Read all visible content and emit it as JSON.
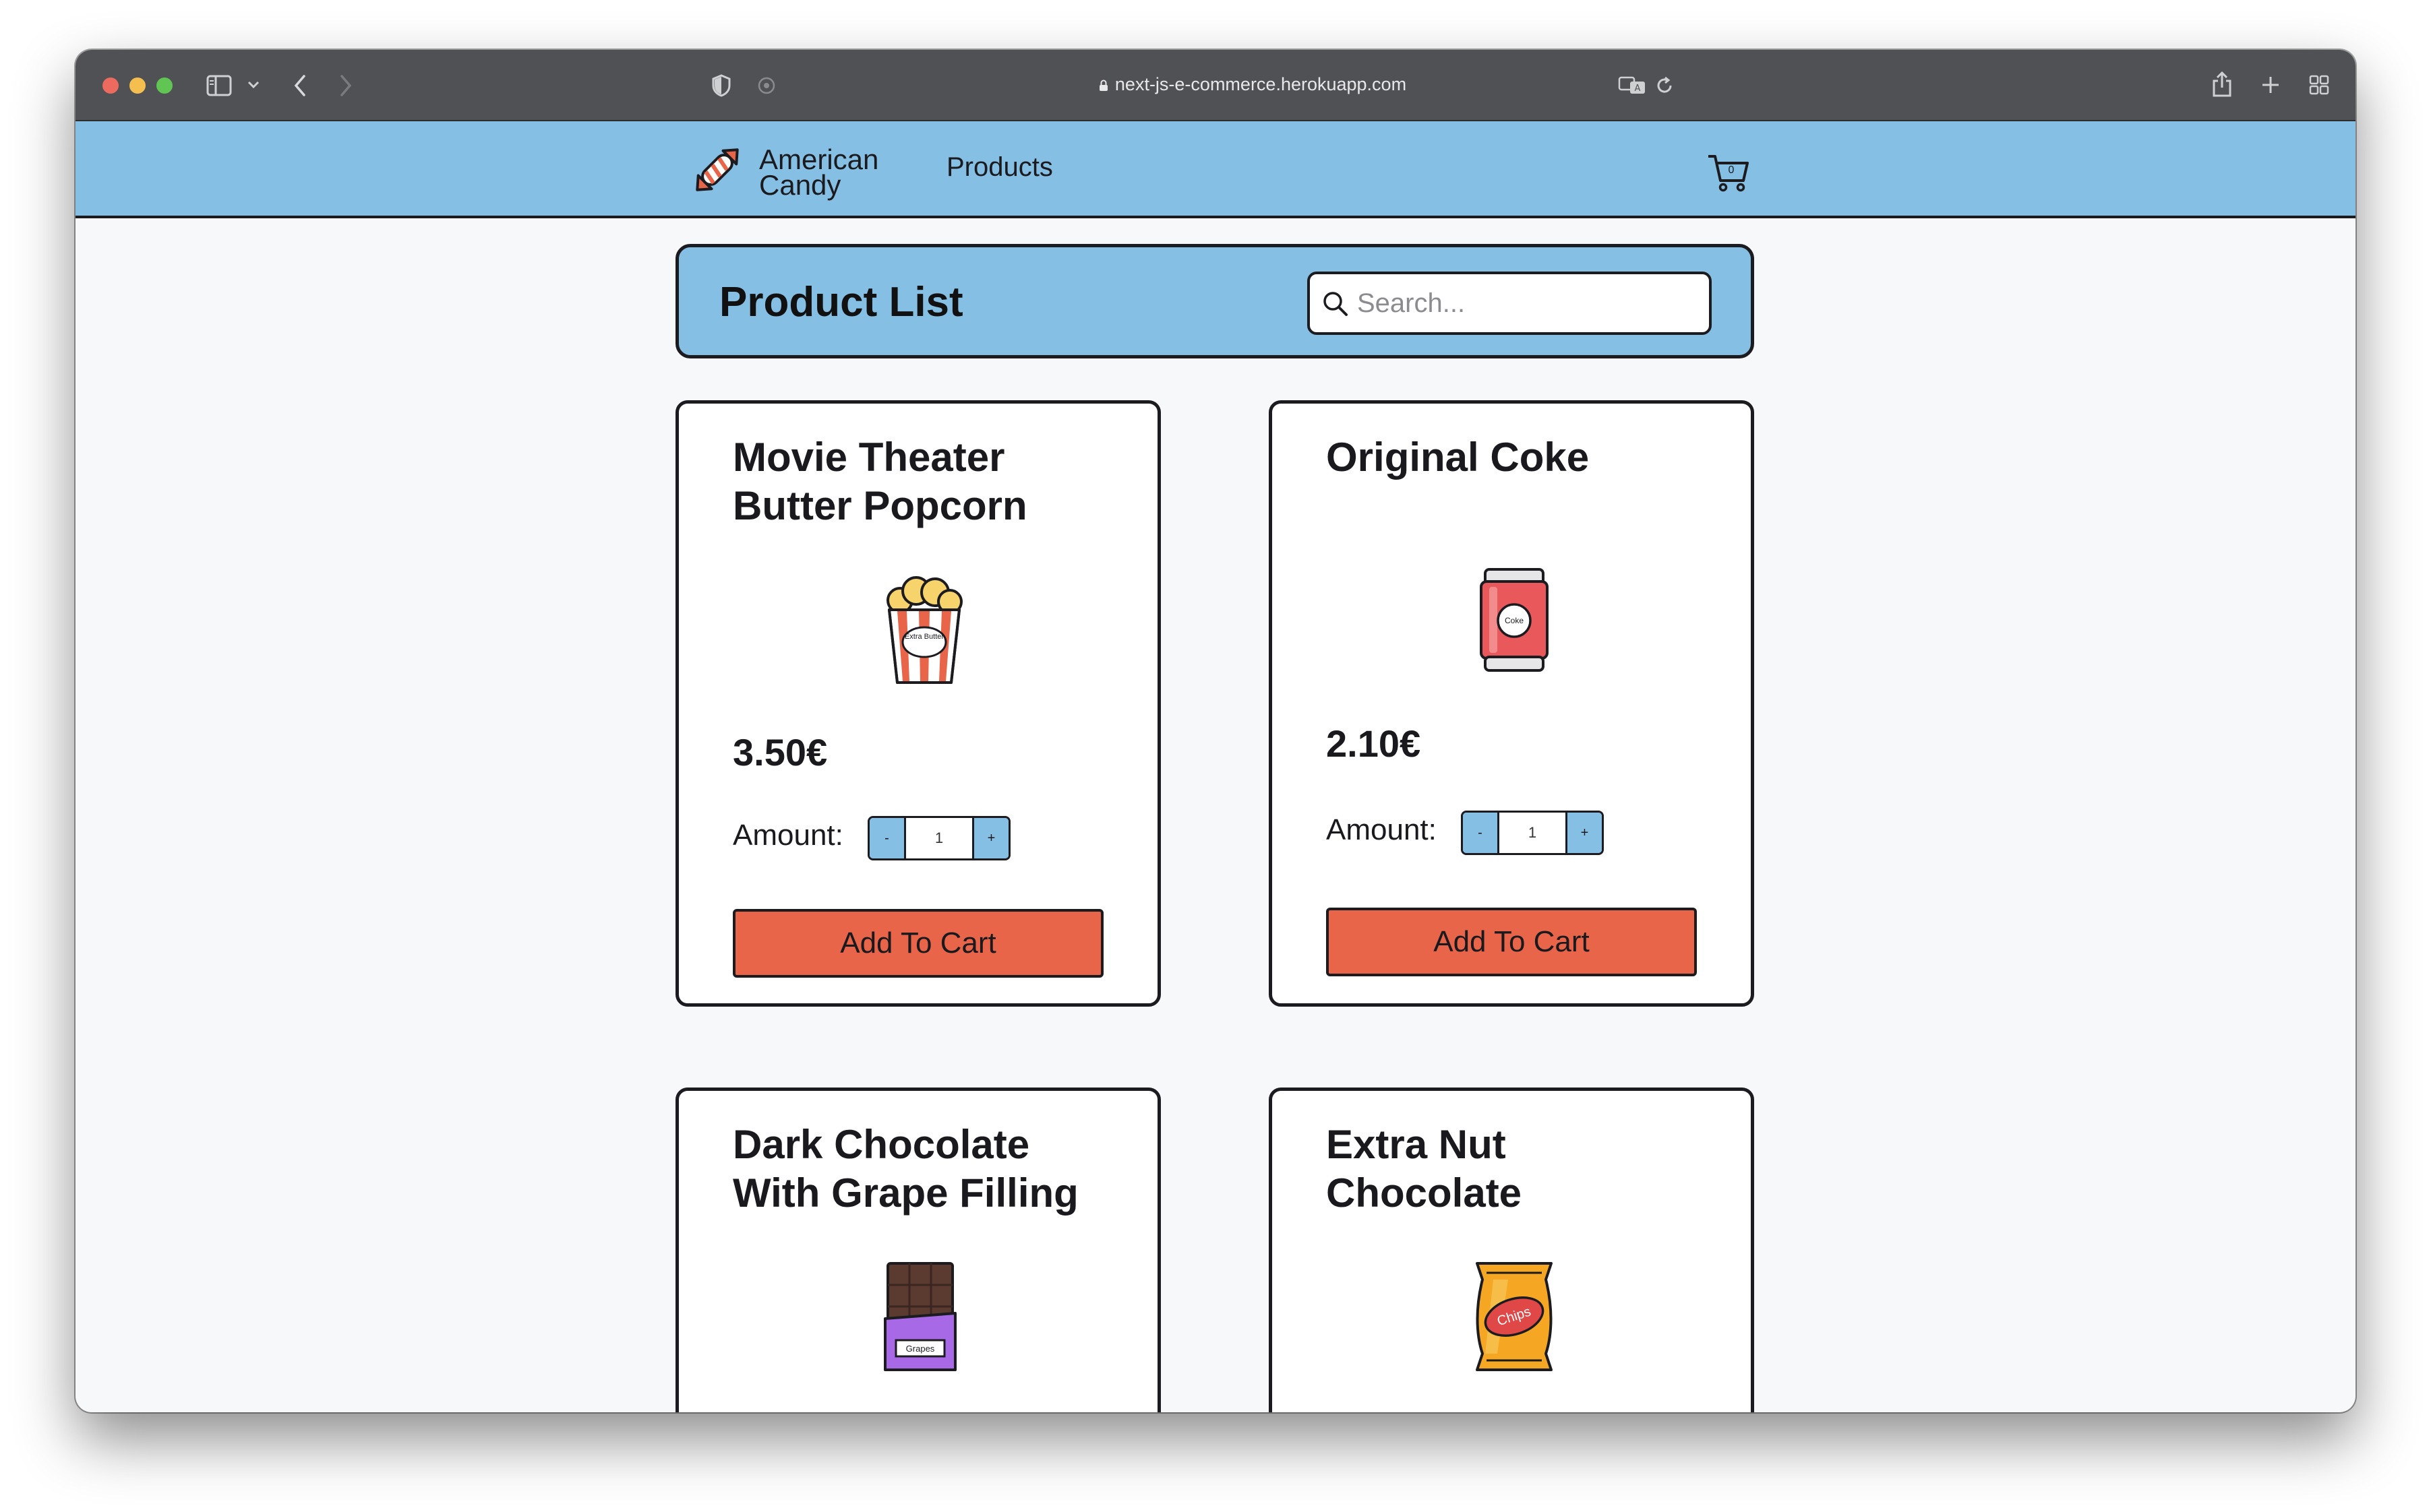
{
  "browser": {
    "url": "next-js-e-commerce.herokuapp.com"
  },
  "site": {
    "brand_line1": "American",
    "brand_line2": "Candy",
    "nav_products": "Products",
    "cart_count": "0"
  },
  "header": {
    "title": "Product List",
    "search_placeholder": "Search..."
  },
  "products": [
    {
      "title_line1": "Movie Theater",
      "title_line2": "Butter Popcorn",
      "image_label": "Extra Butter",
      "price": "3.50€",
      "amount_label": "Amount:",
      "amount": "1",
      "minus": "-",
      "plus": "+",
      "button": "Add To Cart"
    },
    {
      "title_line1": "Original Coke",
      "title_line2": "",
      "image_label": "Coke",
      "price": "2.10€",
      "amount_label": "Amount:",
      "amount": "1",
      "minus": "-",
      "plus": "+",
      "button": "Add To Cart"
    },
    {
      "title_line1": "Dark Chocolate",
      "title_line2": "With Grape Filling",
      "image_label": "Grapes"
    },
    {
      "title_line1": "Extra Nut",
      "title_line2": "Chocolate",
      "image_label": "Chips"
    }
  ],
  "colors": {
    "header_blue": "#86bfe4",
    "button_orange": "#e9654a",
    "border_dark": "#1c1c20"
  },
  "icons": [
    "sidebar-icon",
    "chevron-down-icon",
    "back-icon",
    "forward-icon",
    "shield-icon",
    "extension-icon",
    "lock-icon",
    "translate-icon",
    "reload-icon",
    "share-icon",
    "new-tab-icon",
    "tab-overview-icon",
    "candy-logo-icon",
    "cart-icon",
    "search-icon"
  ]
}
